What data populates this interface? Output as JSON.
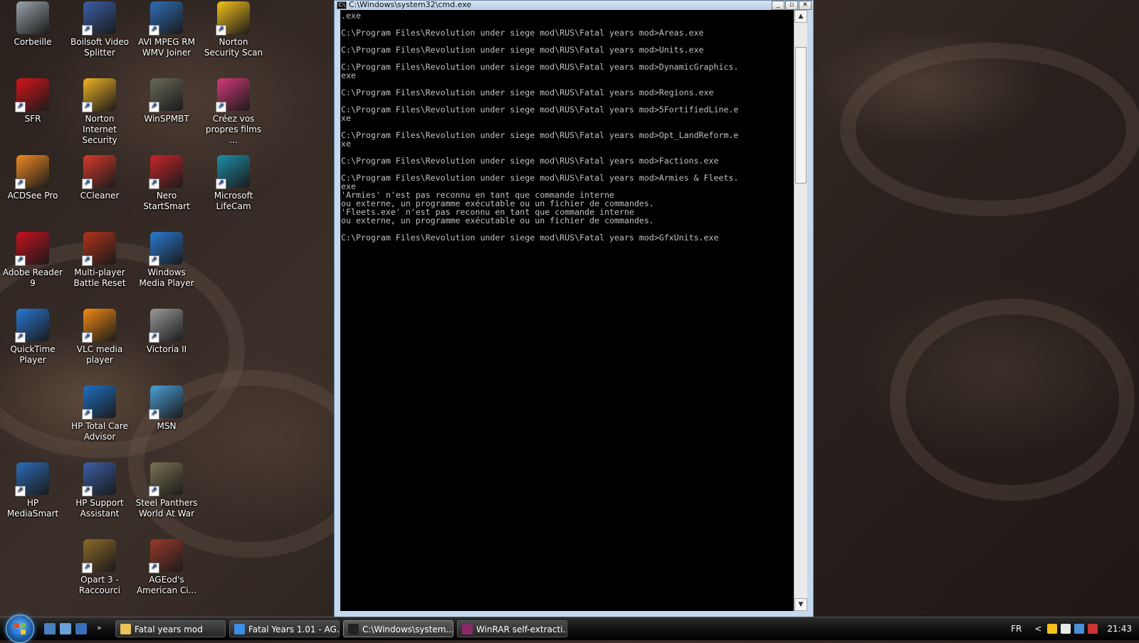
{
  "desktop": {
    "icons": [
      {
        "label": "Corbeille",
        "icon": "recycle-bin-icon",
        "color": "#9aa3ad"
      },
      {
        "label": "Boilsoft Video Splitter",
        "icon": "scissors-icon",
        "color": "#3b5fa8"
      },
      {
        "label": "AVI MPEG RM WMV Joiner",
        "icon": "film-icon",
        "color": "#2e6fb7"
      },
      {
        "label": "Norton Security Scan",
        "icon": "norton-icon",
        "color": "#f5c21b"
      },
      {
        "label": "SFR",
        "icon": "sfr-icon",
        "color": "#d7141a"
      },
      {
        "label": "Norton Internet Security",
        "icon": "globe-icon",
        "color": "#f0b323"
      },
      {
        "label": "WinSPMBT",
        "icon": "soldier-icon",
        "color": "#6a6a5a"
      },
      {
        "label": "Créez vos propres films ...",
        "icon": "clapper-icon",
        "color": "#d23a78"
      },
      {
        "label": "ACDSee Pro",
        "icon": "acdsee-icon",
        "color": "#f08a24"
      },
      {
        "label": "CCleaner",
        "icon": "ccleaner-icon",
        "color": "#d83a2b"
      },
      {
        "label": "Nero StartSmart",
        "icon": "nero-icon",
        "color": "#c9252b"
      },
      {
        "label": "Microsoft LifeCam",
        "icon": "webcam-icon",
        "color": "#1d8fa8"
      },
      {
        "label": "Adobe Reader 9",
        "icon": "pdf-icon",
        "color": "#c8101e"
      },
      {
        "label": "Multi-player Battle Reset",
        "icon": "fire-icon",
        "color": "#b2341b"
      },
      {
        "label": "Windows Media Player",
        "icon": "media-player-icon",
        "color": "#2a7ad4"
      },
      {
        "label": "QuickTime Player",
        "icon": "quicktime-icon",
        "color": "#2877d3"
      },
      {
        "label": "VLC media player",
        "icon": "traffic-cone-icon",
        "color": "#f28a13"
      },
      {
        "label": "Victoria II",
        "icon": "victoria-icon",
        "color": "#9a9a9a"
      },
      {
        "label": "HP Total Care Advisor",
        "icon": "hp-advisor-icon",
        "color": "#1f6fc2"
      },
      {
        "label": "MSN",
        "icon": "msn-buddies-icon",
        "color": "#4aa0d8"
      },
      {
        "label": "HP MediaSmart",
        "icon": "hp-mediasmart-icon",
        "color": "#2b6db8"
      },
      {
        "label": "HP Support Assistant",
        "icon": "help-icon",
        "color": "#3b5fa8"
      },
      {
        "label": "Steel Panthers World At War",
        "icon": "steel-panthers-icon",
        "color": "#7a7454"
      },
      {
        "label": "Opart 3 - Raccourci",
        "icon": "opart-icon",
        "color": "#8a6a2a"
      },
      {
        "label": "AGEod's American Ci...",
        "icon": "aacw-icon",
        "color": "#9a3a2a"
      }
    ]
  },
  "cmd_window": {
    "title": "C:\\Windows\\system32\\cmd.exe",
    "buttons": {
      "minimize": "_",
      "maximize": "▫",
      "close": "✕"
    },
    "output": ".exe\n\nC:\\Program Files\\Revolution under siege mod\\RUS\\Fatal years mod>Areas.exe\n\nC:\\Program Files\\Revolution under siege mod\\RUS\\Fatal years mod>Units.exe\n\nC:\\Program Files\\Revolution under siege mod\\RUS\\Fatal years mod>DynamicGraphics.\nexe\n\nC:\\Program Files\\Revolution under siege mod\\RUS\\Fatal years mod>Regions.exe\n\nC:\\Program Files\\Revolution under siege mod\\RUS\\Fatal years mod>5FortifiedLine.e\nxe\n\nC:\\Program Files\\Revolution under siege mod\\RUS\\Fatal years mod>Opt_LandReform.e\nxe\n\nC:\\Program Files\\Revolution under siege mod\\RUS\\Fatal years mod>Factions.exe\n\nC:\\Program Files\\Revolution under siege mod\\RUS\\Fatal years mod>Armies & Fleets.\nexe\n'Armies' n'est pas reconnu en tant que commande interne\nou externe, un programme exécutable ou un fichier de commandes.\n'Fleets.exe' n'est pas reconnu en tant que commande interne\nou externe, un programme exécutable ou un fichier de commandes.\n\nC:\\Program Files\\Revolution under siege mod\\RUS\\Fatal years mod>GfxUnits.exe"
  },
  "taskbar": {
    "more": "»",
    "buttons": [
      {
        "label": "Fatal years mod",
        "icon": "folder-icon",
        "color": "#e8c25a"
      },
      {
        "label": "Fatal Years 1.01 - AG...",
        "icon": "ie-icon",
        "color": "#3a8ee6"
      },
      {
        "label": "C:\\Windows\\system...",
        "icon": "cmd-icon",
        "color": "#222222"
      },
      {
        "label": "WinRAR self-extracti...",
        "icon": "winrar-icon",
        "color": "#8a2a6a"
      }
    ],
    "tray": {
      "language": "FR",
      "chevron": "<",
      "time": "21:43"
    }
  }
}
